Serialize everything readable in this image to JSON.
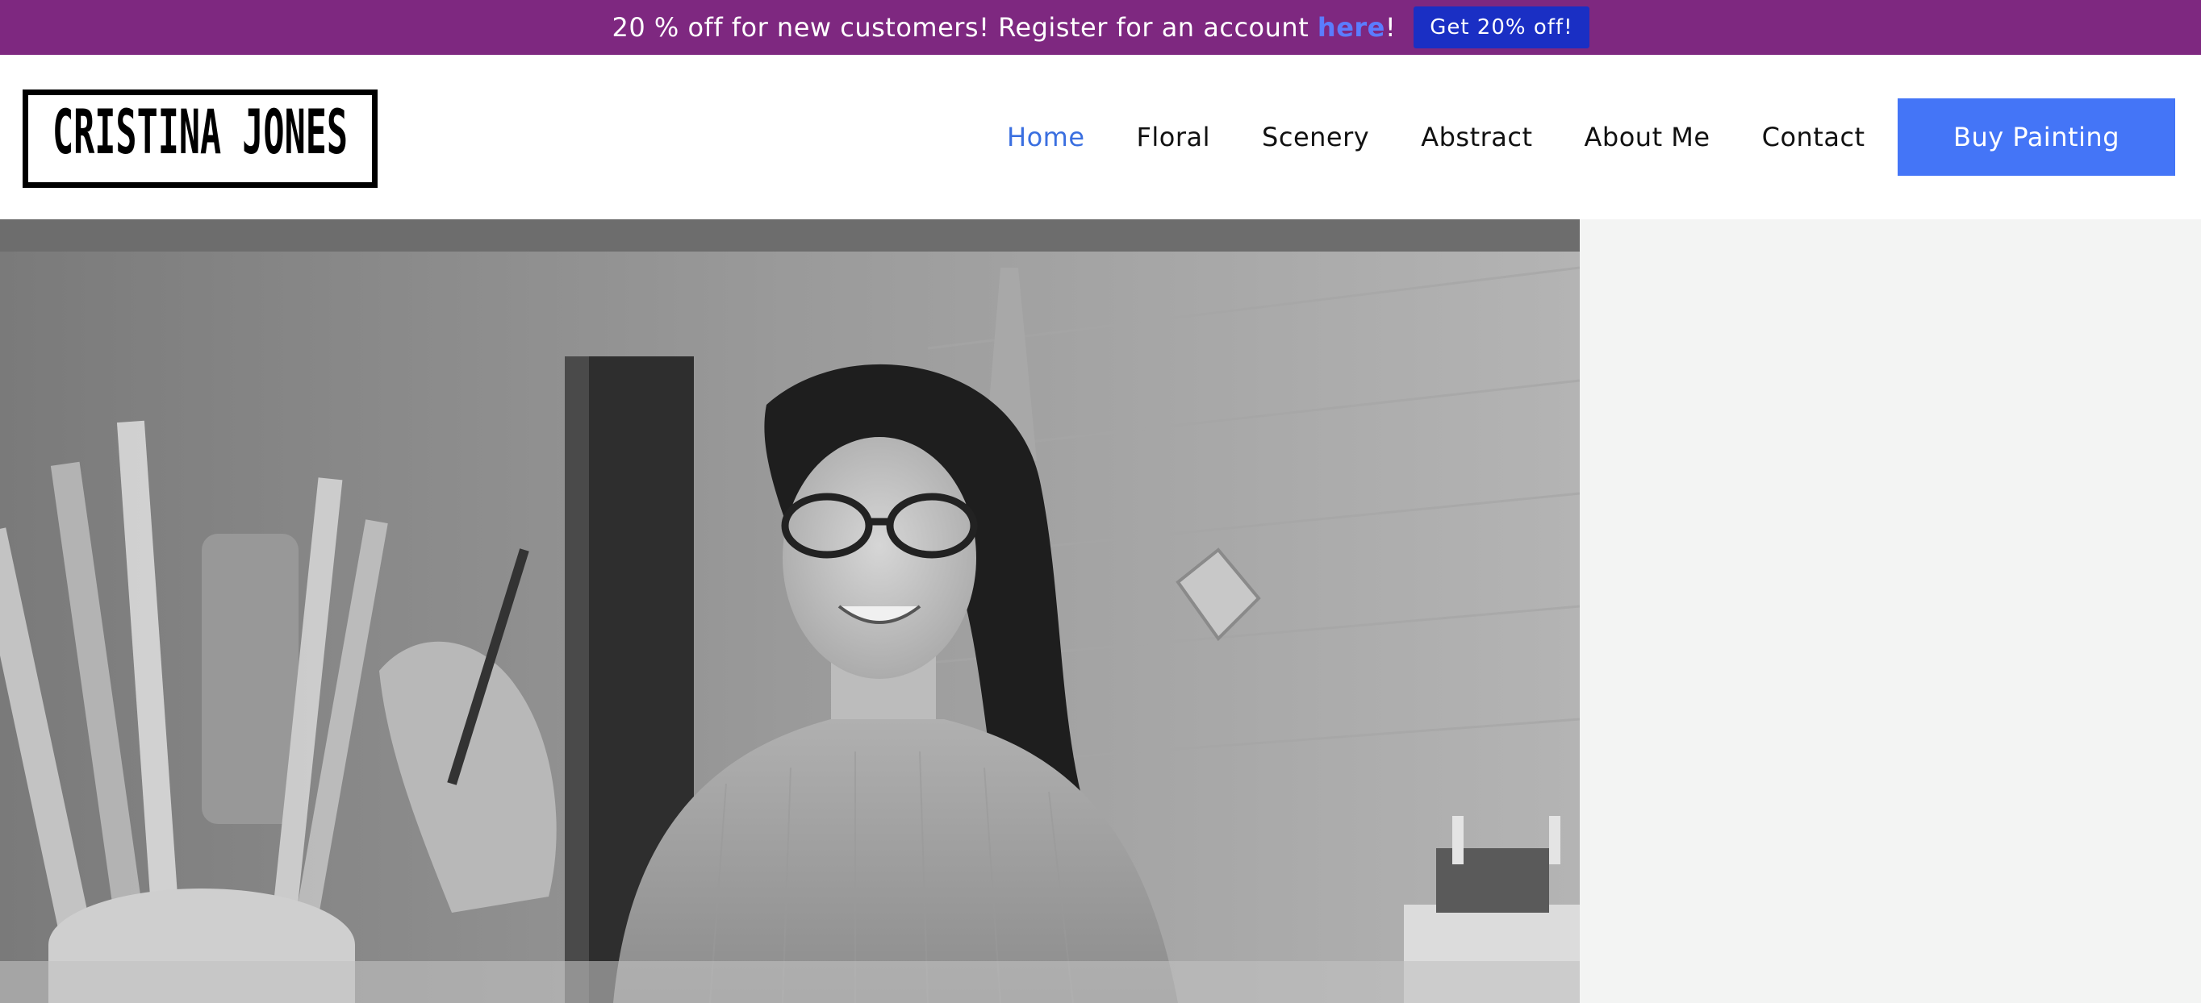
{
  "promo": {
    "message": "20 % off for new customers! Register for an account ",
    "link_text": "here",
    "suffix": "!",
    "button_label": "Get 20% off!"
  },
  "header": {
    "logo_text": "CRISTINA JONES",
    "nav": [
      {
        "label": "Home",
        "active": true
      },
      {
        "label": "Floral",
        "active": false
      },
      {
        "label": "Scenery",
        "active": false
      },
      {
        "label": "Abstract",
        "active": false
      },
      {
        "label": "About Me",
        "active": false
      },
      {
        "label": "Contact",
        "active": false
      }
    ],
    "buy_button_label": "Buy Painting"
  },
  "colors": {
    "promo_bg": "#7e2880",
    "accent": "#4475f7",
    "nav_active": "#3a6fe0",
    "promo_button": "#1a2fc4",
    "side_panel": "#f3f4f3"
  },
  "hero": {
    "image": "grayscale-photo-woman-painting"
  }
}
